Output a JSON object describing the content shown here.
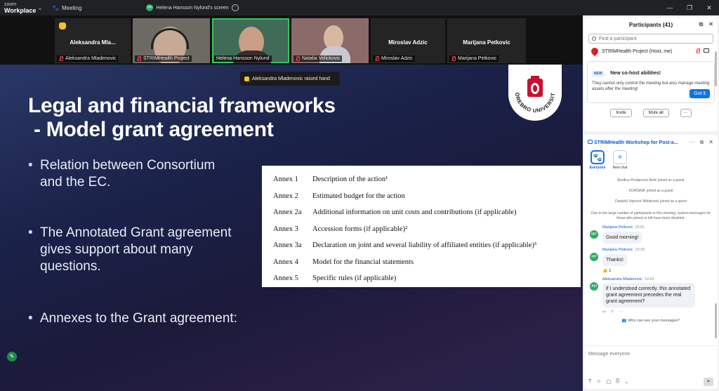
{
  "titlebar": {
    "brand_top": "zoom",
    "brand_bottom": "Workplace",
    "meeting_label": "Meeting",
    "screen_badge": "HH",
    "screen_label": "Helena Hansson Nylund's screen"
  },
  "video_strip": [
    {
      "name": "Aleksandra  Mla...",
      "label": "Aleksandra Mladenovic",
      "muted": true,
      "has_video": false,
      "hand_raised": true
    },
    {
      "name": "",
      "label": "STRIMHealth Project",
      "muted": true,
      "has_video": true
    },
    {
      "name": "",
      "label": "Helena Hansson Nylund",
      "muted": false,
      "has_video": true,
      "active": true
    },
    {
      "name": "",
      "label": "Natalia Velickovic",
      "muted": true,
      "has_video": true
    },
    {
      "name": "Miroslav Adzic",
      "label": "Miroslav Adzic",
      "muted": true,
      "has_video": false
    },
    {
      "name": "Marijana Petkovic",
      "label": "Marijana Petkovic",
      "muted": true,
      "has_video": false
    }
  ],
  "share": {
    "toast": "Aleksandra Mladenovic raised hand",
    "title_line1": "Legal and financial frameworks",
    "title_line2": " - Model grant agreement",
    "bullet1": [
      "Relation between Consortium",
      "and the EC."
    ],
    "bullet2": [
      "The Annotated Grant agreement",
      "gives support about many",
      "questions."
    ],
    "bullet3": [
      "Annexes to the Grant agreement:"
    ],
    "annexes": [
      {
        "k": "Annex 1",
        "v": "Description of the action¹"
      },
      {
        "k": "Annex 2",
        "v": "Estimated budget for the action"
      },
      {
        "k": "Annex 2a",
        "v": "Additional information on unit costs and contributions (if applicable)"
      },
      {
        "k": "Annex 3",
        "v": "Accession forms (if applicable)²"
      },
      {
        "k": "Annex 3a",
        "v": "Declaration on joint and several liability of affiliated entities (if applicable)³"
      },
      {
        "k": "Annex 4",
        "v": "Model for the financial statements"
      },
      {
        "k": "Annex 5",
        "v": "Specific rules (if applicable)"
      }
    ],
    "logo_text": "ÖREBRO UNIVERSITY",
    "logo_color": "#c8102e"
  },
  "participants": {
    "title": "Participants (41)",
    "search_placeholder": "Find a participant",
    "me_row": "STRIMHealth Project (Host, me)",
    "cohost_badge": "NEW",
    "cohost_title": "New co-host abilities!",
    "cohost_desc": "They cannot only control the meeting but also manage meeting assets after the meeting!",
    "got_it": "Got it",
    "invite": "Invite",
    "mute_all": "Mute all",
    "more": "···"
  },
  "chat": {
    "title": "STRIMHealth Workshop for Post-a...",
    "tab_everyone": "Everyone",
    "tab_new_chat": "New chat",
    "system": [
      "Đurđica Prodanović Antić joined as a guest",
      "KORISNIK joined as a guest",
      "Danijela Vojnović Milutinović joined as a guest",
      "Due to the large number of participants in this meeting, system messages for those who joined or left have been disabled."
    ],
    "messages": [
      {
        "initials": "MP",
        "sender": "Marijana Petkovic",
        "time": "10:01",
        "text": "Good morning!",
        "color": "#2eaa6b"
      },
      {
        "initials": "MP",
        "sender": "Marijana Petkovic",
        "time": "10:29",
        "text": "Thanks!",
        "color": "#2eaa6b"
      },
      {
        "initials": "AM",
        "sender": "Aleksandra Mladenovic",
        "time": "10:42",
        "text": "if I understood correctly, this annotated  grant agreement precedes the real grant agreement?",
        "color": "#2eaa6b"
      }
    ],
    "reaction": "👍 1",
    "who_can_see": "Who can see your messages?",
    "input_placeholder": "Message everyone"
  },
  "colors": {
    "accent": "#0e72ed",
    "green": "#2eaa6b"
  }
}
